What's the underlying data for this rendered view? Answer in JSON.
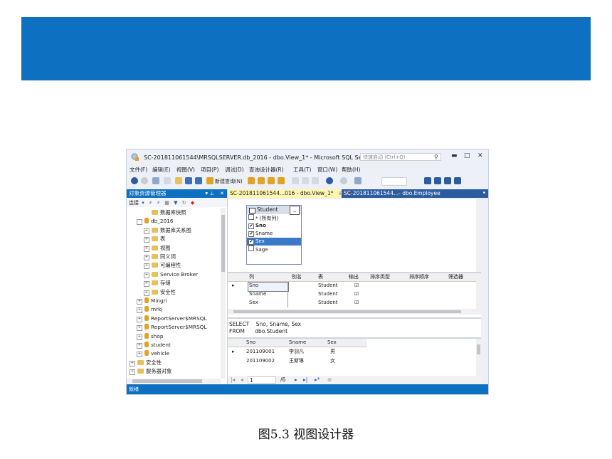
{
  "colors": {
    "banner": "#0d70c1",
    "accent": "#0d70c1",
    "tab_active": "#fff6b3",
    "selection": "#3b78c8"
  },
  "window": {
    "title": "SC-201811061544\\MRSQLSERVER.db_2016 - dbo.View_1* - Microsoft SQL Server Ma...",
    "quick_launch": "快速启动 (Ctrl+Q)"
  },
  "menu": [
    "文件(F)",
    "编辑(E)",
    "视图(V)",
    "项目(P)",
    "调试(D)",
    "查询设计器(R)",
    "工具(T)",
    "窗口(W)",
    "帮助(H)"
  ],
  "toolbar": {
    "new_query": "新建查询(N)"
  },
  "explorer": {
    "title": "对象资源管理器",
    "connect": "连接",
    "nodes": [
      {
        "label": "数据库快照",
        "indent": 2,
        "kind": "folder",
        "exp": ""
      },
      {
        "label": "db_2016",
        "indent": 1,
        "kind": "db",
        "exp": "-"
      },
      {
        "label": "数据库关系图",
        "indent": 2,
        "kind": "folder",
        "exp": "+"
      },
      {
        "label": "表",
        "indent": 2,
        "kind": "folder",
        "exp": "+"
      },
      {
        "label": "视图",
        "indent": 2,
        "kind": "folder",
        "exp": "+"
      },
      {
        "label": "同义词",
        "indent": 2,
        "kind": "folder",
        "exp": "+"
      },
      {
        "label": "可编程性",
        "indent": 2,
        "kind": "folder",
        "exp": "+"
      },
      {
        "label": "Service Broker",
        "indent": 2,
        "kind": "folder",
        "exp": "+"
      },
      {
        "label": "存储",
        "indent": 2,
        "kind": "folder",
        "exp": "+"
      },
      {
        "label": "安全性",
        "indent": 2,
        "kind": "folder",
        "exp": "+"
      },
      {
        "label": "Mingri",
        "indent": 1,
        "kind": "db",
        "exp": "+"
      },
      {
        "label": "mrkj",
        "indent": 1,
        "kind": "db",
        "exp": "+"
      },
      {
        "label": "ReportServer$MRSQL",
        "indent": 1,
        "kind": "db",
        "exp": "+"
      },
      {
        "label": "ReportServer$MRSQL",
        "indent": 1,
        "kind": "db",
        "exp": "+"
      },
      {
        "label": "shop",
        "indent": 1,
        "kind": "db",
        "exp": "+"
      },
      {
        "label": "student",
        "indent": 1,
        "kind": "db",
        "exp": "+"
      },
      {
        "label": "vehicle",
        "indent": 1,
        "kind": "db",
        "exp": "+"
      },
      {
        "label": "安全性",
        "indent": 0,
        "kind": "folder",
        "exp": "+"
      },
      {
        "label": "服务器对象",
        "indent": 0,
        "kind": "folder",
        "exp": "+"
      }
    ]
  },
  "tabs": {
    "active": "SC-201811061544...016 - dbo.View_1*",
    "inactive": "SC-201811061544...- dbo.Employee"
  },
  "diagram": {
    "table_name": "Student",
    "columns": [
      {
        "label": "* (所有列)",
        "checked": false,
        "selected": false,
        "bold": false
      },
      {
        "label": "Sno",
        "checked": true,
        "selected": false,
        "bold": true
      },
      {
        "label": "Sname",
        "checked": true,
        "selected": false,
        "bold": false
      },
      {
        "label": "Sex",
        "checked": true,
        "selected": true,
        "bold": false
      },
      {
        "label": "Sage",
        "checked": false,
        "selected": false,
        "bold": false
      }
    ]
  },
  "criteria": {
    "headers": [
      "列",
      "别名",
      "表",
      "输出",
      "排序类型",
      "排序顺序",
      "筛选器"
    ],
    "rows": [
      {
        "col": "Sno",
        "table": "Student",
        "output": true
      },
      {
        "col": "Sname",
        "table": "Student",
        "output": true
      },
      {
        "col": "Sex",
        "table": "Student",
        "output": true
      }
    ]
  },
  "sql": {
    "line1": "SELECT    Sno, Sname, Sex",
    "line2": "FROM      dbo.Student"
  },
  "results": {
    "headers": [
      "Sno",
      "Sname",
      "Sex"
    ],
    "rows": [
      [
        "201109001",
        "李羽凡",
        "男"
      ],
      [
        "201109002",
        "王斯琳",
        "女"
      ]
    ]
  },
  "nav": {
    "record": "1",
    "total": "/6"
  },
  "status": "就绪",
  "caption": "图5.3  视图设计器"
}
